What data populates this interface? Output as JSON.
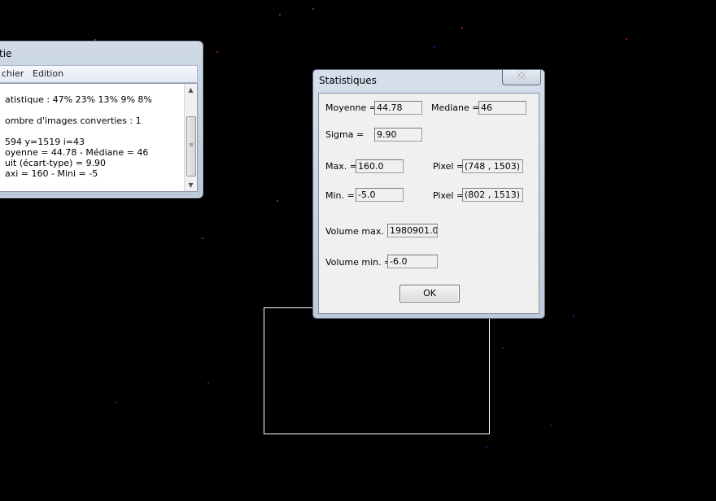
{
  "colors": {
    "desktop_bg": "#000000",
    "window_frame": "#c4d2e2",
    "dialog_client": "#f0f0f0"
  },
  "back_window": {
    "title_fragment": "tie",
    "menu": [
      "chier",
      "Edition"
    ],
    "lines": [
      "atistique : 47% 23% 13% 9% 8%",
      "ombre d'images converties : 1",
      "594   y=1519  i=43",
      "oyenne = 44.78  -  Médiane = 46",
      "uit (écart-type) = 9.90",
      "axi = 160  -  Mini = -5"
    ]
  },
  "dialog": {
    "title": "Statistiques",
    "close_symbol": "✕",
    "moyenne_label": "Moyenne =",
    "moyenne_value": "44.78",
    "mediane_label": "Mediane =",
    "mediane_value": "46",
    "sigma_label": "Sigma =",
    "sigma_value": "9.90",
    "max_label": "Max. =",
    "max_value": "160.0",
    "pixel_label": "Pixel =",
    "max_pixel_value": "(748 , 1503)",
    "min_label": "Min. =",
    "min_value": "-5.0",
    "min_pixel_value": "(802 , 1513)",
    "volume_max_label": "Volume max. =",
    "volume_max_value": "1980901.0",
    "volume_min_label": "Volume min. =",
    "volume_min_value": "-6.0",
    "ok_label": "OK"
  }
}
